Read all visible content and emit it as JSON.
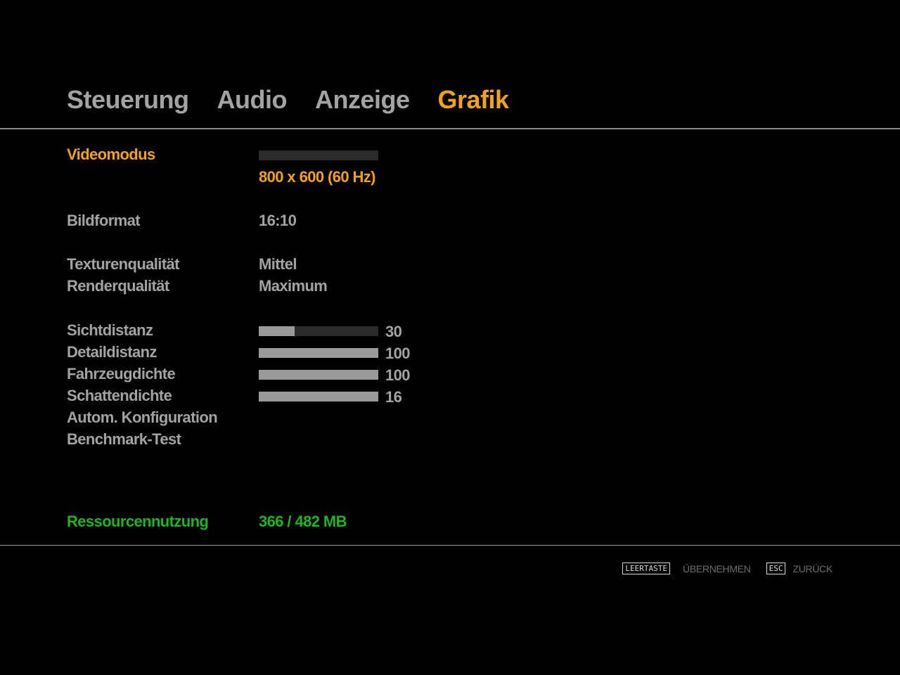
{
  "tabs": [
    {
      "label": "Steuerung",
      "active": false
    },
    {
      "label": "Audio",
      "active": false
    },
    {
      "label": "Anzeige",
      "active": false
    },
    {
      "label": "Grafik",
      "active": true
    }
  ],
  "settings": {
    "videomode": {
      "label": "Videomodus",
      "value": "800 x 600 (60 Hz)"
    },
    "aspect": {
      "label": "Bildformat",
      "value": "16:10"
    },
    "texture_quality": {
      "label": "Texturenqualität",
      "value": "Mittel"
    },
    "render_quality": {
      "label": "Renderqualität",
      "value": "Maximum"
    },
    "view_distance": {
      "label": "Sichtdistanz",
      "value": "30",
      "fill_percent": 30
    },
    "detail_distance": {
      "label": "Detaildistanz",
      "value": "100",
      "fill_percent": 100
    },
    "vehicle_density": {
      "label": "Fahrzeugdichte",
      "value": "100",
      "fill_percent": 100
    },
    "shadow_density": {
      "label": "Schattendichte",
      "value": "16",
      "fill_percent": 100
    },
    "auto_config": {
      "label": "Autom. Konfiguration"
    },
    "benchmark": {
      "label": "Benchmark-Test"
    },
    "resource_usage": {
      "label": "Ressourcennutzung",
      "value": "366 / 482 MB"
    }
  },
  "footer": {
    "apply_key": "LEERTASTE",
    "apply_label": "ÜBERNEHMEN",
    "back_key": "ESC",
    "back_label": "ZURÜCK"
  },
  "colors": {
    "active": "#f2a31b",
    "inactive": "#a3a3a3",
    "resource": "#1fb51f",
    "background": "#000000"
  }
}
